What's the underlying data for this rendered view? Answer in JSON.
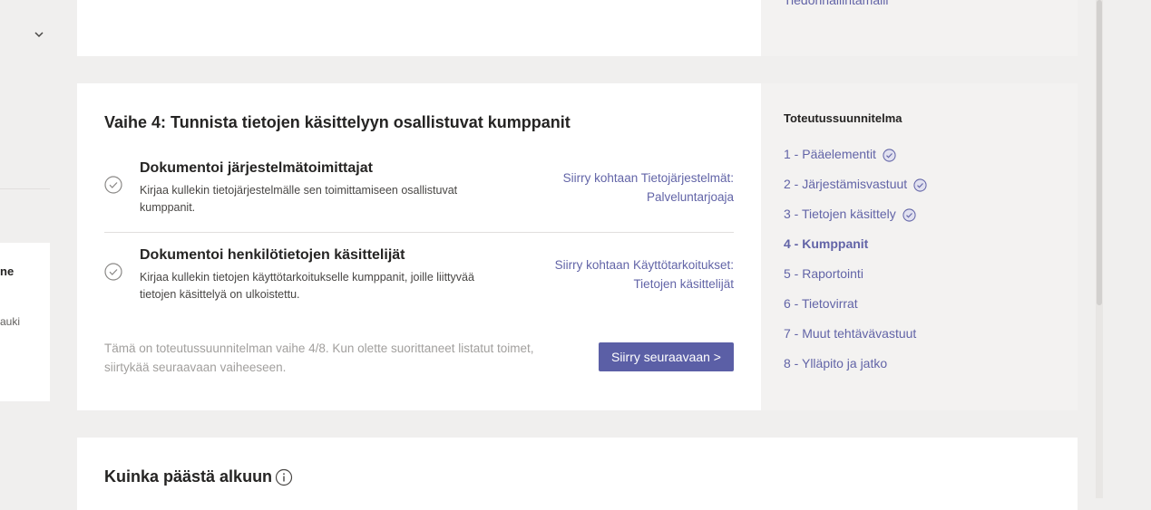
{
  "left_panel": {
    "partial_title": "ne",
    "partial_text": "auki"
  },
  "top_card": {
    "partial_link": "Tiedonhallintamalli"
  },
  "step": {
    "title": "Vaihe 4: Tunnista tietojen käsittelyyn osallistuvat kumppanit",
    "tasks": [
      {
        "title": "Dokumentoi järjestelmätoimittajat",
        "description": "Kirjaa kullekin tietojärjestelmälle sen toimittamiseen osallistuvat kumppanit.",
        "link": "Siirry kohtaan Tietojärjestelmät: Palveluntarjoaja"
      },
      {
        "title": "Dokumentoi henkilötietojen käsittelijät",
        "description": "Kirjaa kullekin tietojen käyttötarkoitukselle kumppanit, joille liittyvää tietojen käsittelyä on ulkoistettu.",
        "link": "Siirry kohtaan Käyttötarkoitukset: Tietojen käsittelijät"
      }
    ],
    "footer_note": "Tämä on toteutussuunnitelman vaihe 4/8. Kun olette suorittaneet listatut toimet, siirtykää seuraavaan vaiheeseen.",
    "next_button": "Siirry seuraavaan >"
  },
  "plan": {
    "title": "Toteutussuunnitelma",
    "items": [
      {
        "label": "1 - Pääelementit",
        "done": true
      },
      {
        "label": "2 - Järjestämisvastuut",
        "done": true
      },
      {
        "label": "3 - Tietojen käsittely",
        "done": true
      },
      {
        "label": "4 - Kumppanit",
        "active": true
      },
      {
        "label": "5 - Raportointi"
      },
      {
        "label": "6 - Tietovirrat"
      },
      {
        "label": "7 - Muut tehtävävastuut"
      },
      {
        "label": "8 - Ylläpito ja jatko"
      }
    ]
  },
  "bottom": {
    "title": "Kuinka päästä alkuun"
  },
  "colors": {
    "accent": "#6264a7",
    "button": "#5b5fa6",
    "page_bg": "#f0efee",
    "side_bg": "#f3f2f1"
  },
  "icons": [
    "chevron-down-icon",
    "check-circle-icon",
    "info-icon"
  ]
}
